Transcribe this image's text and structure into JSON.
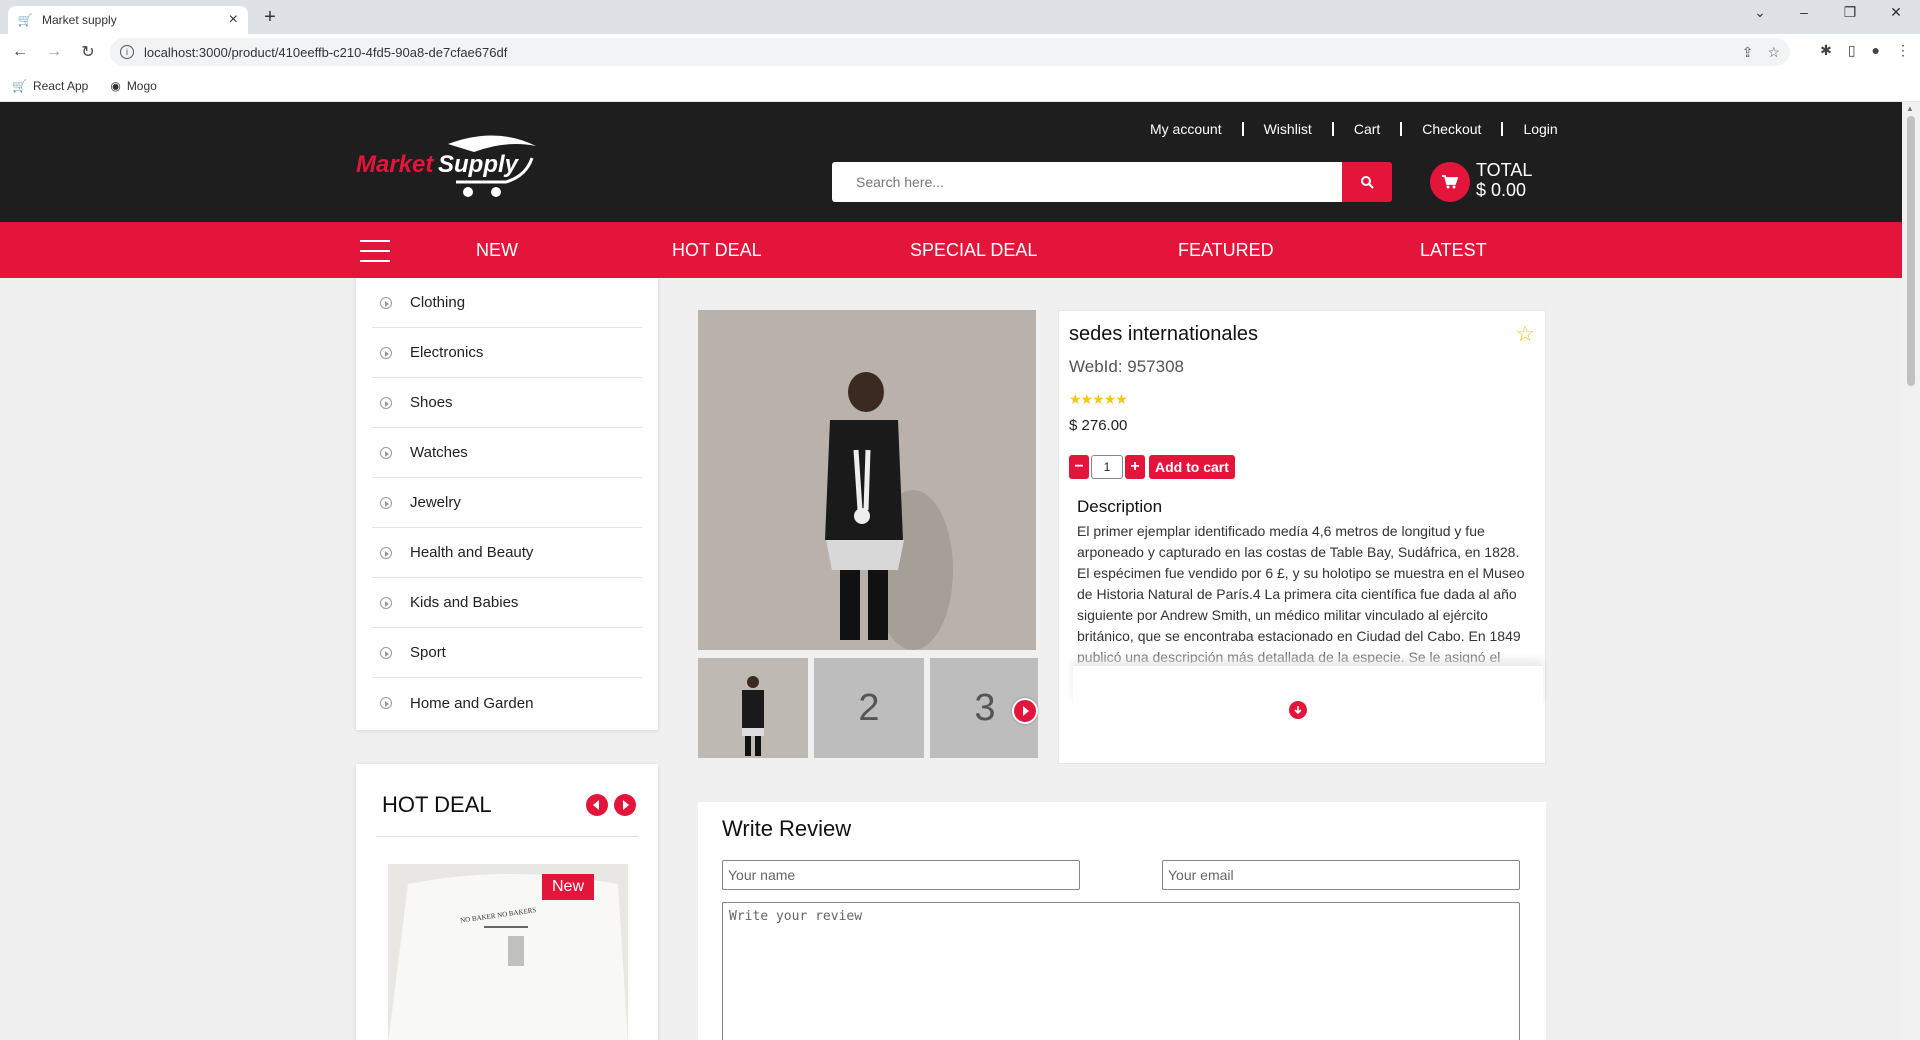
{
  "browser": {
    "tab_title": "Market supply",
    "url": "localhost:3000/product/410eeffb-c210-4fd5-90a8-de7cfae676df",
    "bookmarks": [
      {
        "label": "React App"
      },
      {
        "label": "Mogo"
      }
    ]
  },
  "header": {
    "logo_text_1": "Market",
    "logo_text_2": "Supply",
    "links": [
      "My account",
      "Wishlist",
      "Cart",
      "Checkout",
      "Login"
    ],
    "search_placeholder": "Search here...",
    "total_label": "TOTAL",
    "total_value": "$ 0.00"
  },
  "nav": {
    "items": [
      "NEW",
      "HOT DEAL",
      "SPECIAL DEAL",
      "FEATURED",
      "LATEST"
    ]
  },
  "categories": [
    "Clothing",
    "Electronics",
    "Shoes",
    "Watches",
    "Jewelry",
    "Health and Beauty",
    "Kids and Babies",
    "Sport",
    "Home and Garden"
  ],
  "hot_deal": {
    "title": "HOT DEAL",
    "badge": "New",
    "shirt_text": "NO BAKER NO BAKERS"
  },
  "product": {
    "name": "sedes internationales",
    "webid": "WebId: 957308",
    "rating": 5,
    "stars": "★★★★★",
    "price": "$ 276.00",
    "quantity": "1",
    "add_to_cart": "Add to cart",
    "description_title": "Description",
    "description": "El primer ejemplar identificado medía 4,6 metros de longitud y fue arponeado y capturado en las costas de Table Bay, Sudáfrica, en 1828. El espécimen fue vendido por 6 £, y su holotipo se muestra en el Museo de Historia Natural de París.4 La primera cita científica fue dada al año siguiente por Andrew Smith, un médico militar vinculado al ejército británico, que se encontraba estacionado en Ciudad del Cabo. En 1849 publicó una descripción más detallada de la especie. Se le asignó el nom",
    "thumbs": [
      "2",
      "3"
    ]
  },
  "review": {
    "title": "Write Review",
    "name_placeholder": "Your name",
    "email_placeholder": "Your email",
    "review_placeholder": "Write your review"
  },
  "colors": {
    "accent": "#e4153b",
    "header_bg": "#1e1e1e",
    "star": "#f5c518"
  }
}
